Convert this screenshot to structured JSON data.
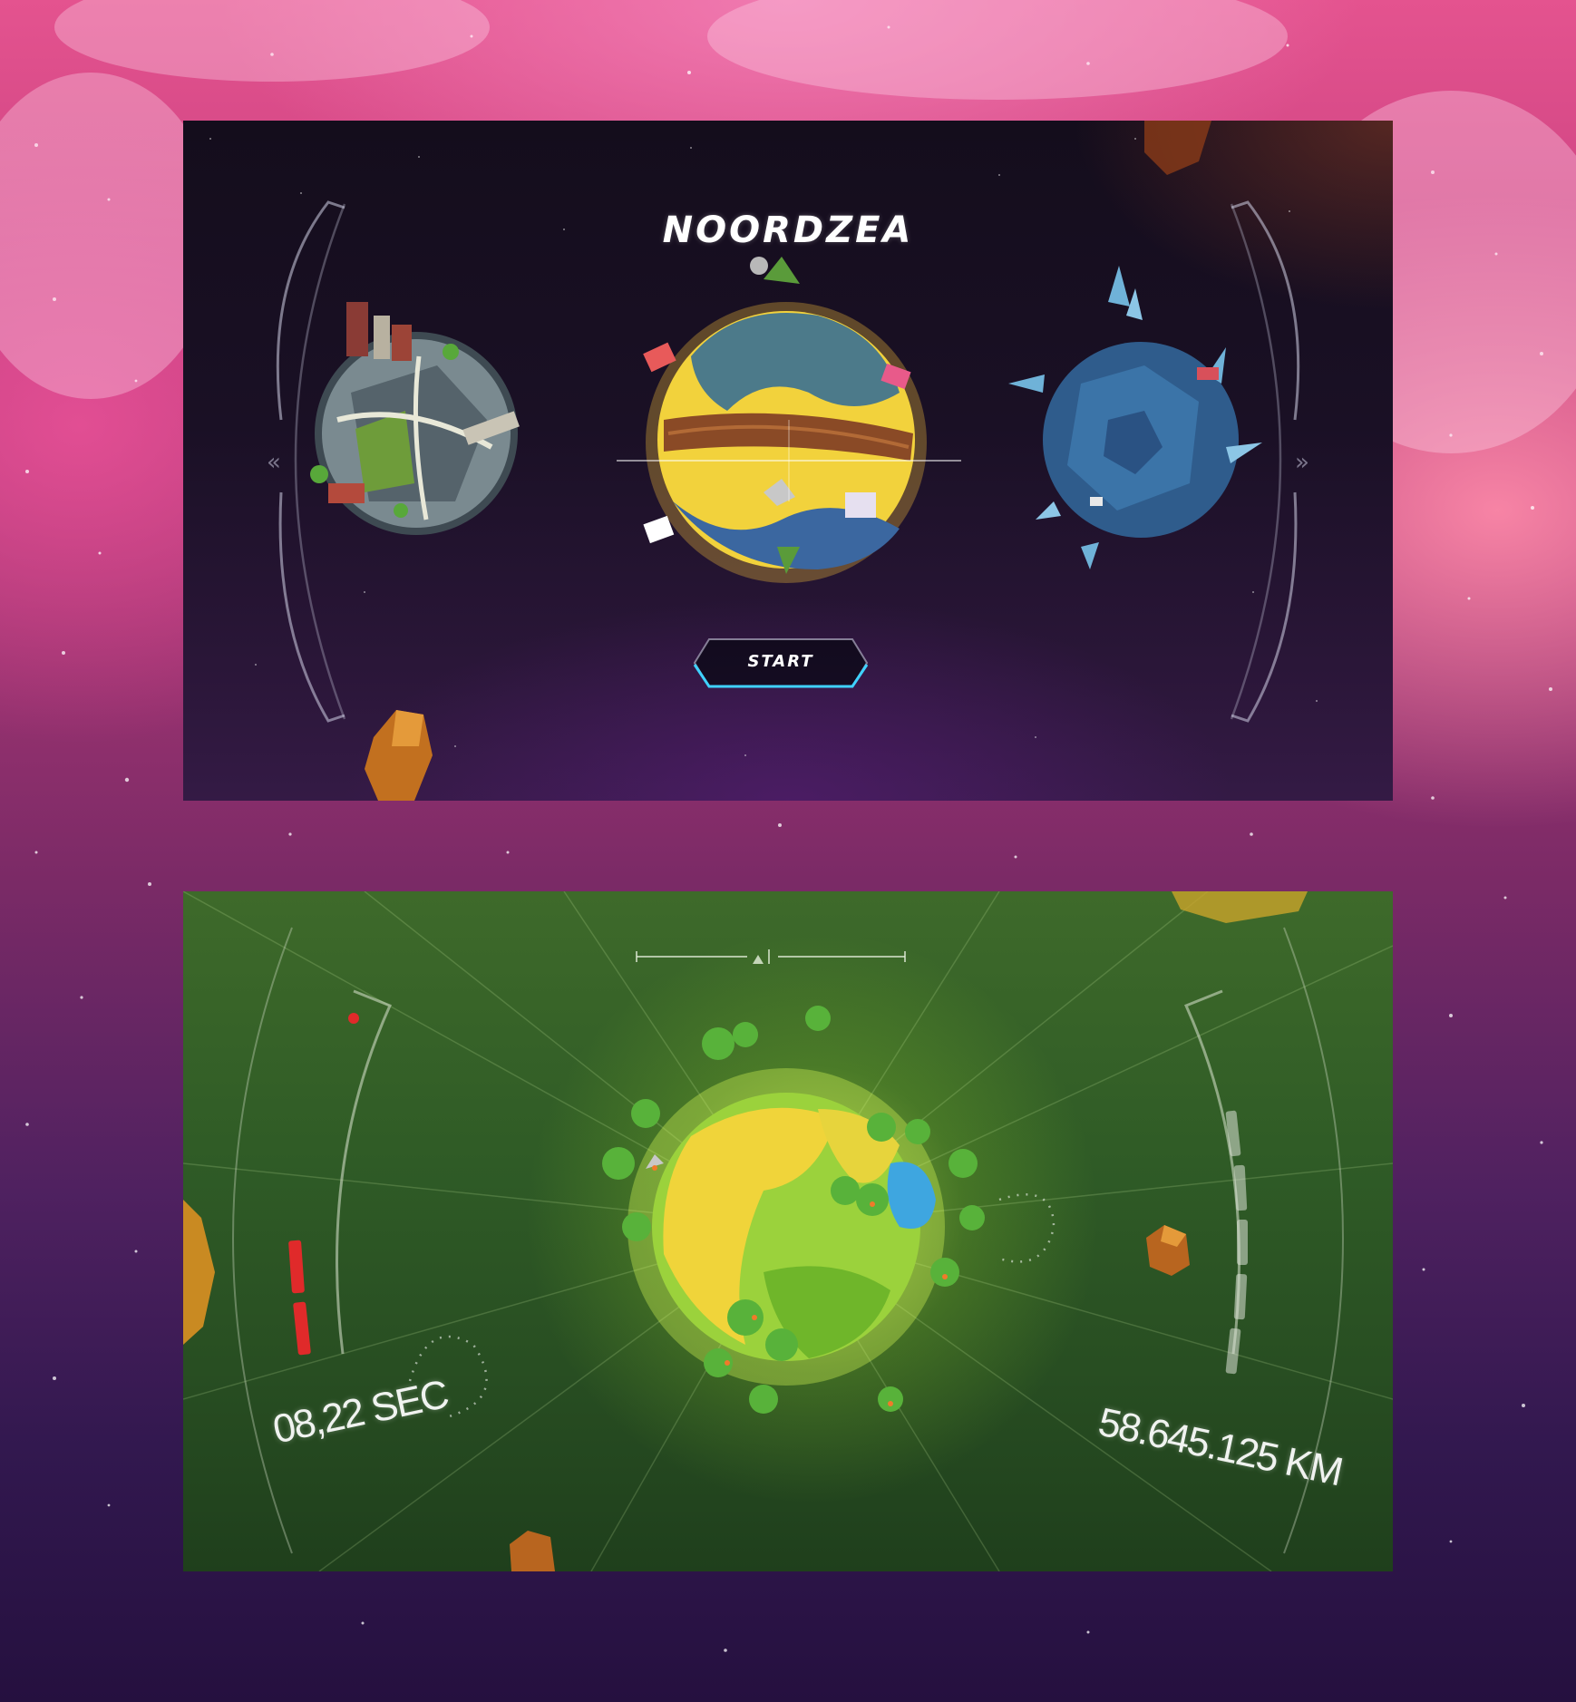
{
  "level_select": {
    "title": "NOORDZEA",
    "start_label": "START",
    "prev_icon": "double-chevron-left-icon",
    "next_icon": "double-chevron-right-icon",
    "planets": [
      "city-planet",
      "beach-planet",
      "crystal-planet"
    ],
    "accent_color": "#3fd2ff"
  },
  "flight": {
    "time": "08,22 SEC",
    "distance": "58.645.125 KM",
    "health_color": "#e02a2a",
    "planet": "forest-planet"
  }
}
